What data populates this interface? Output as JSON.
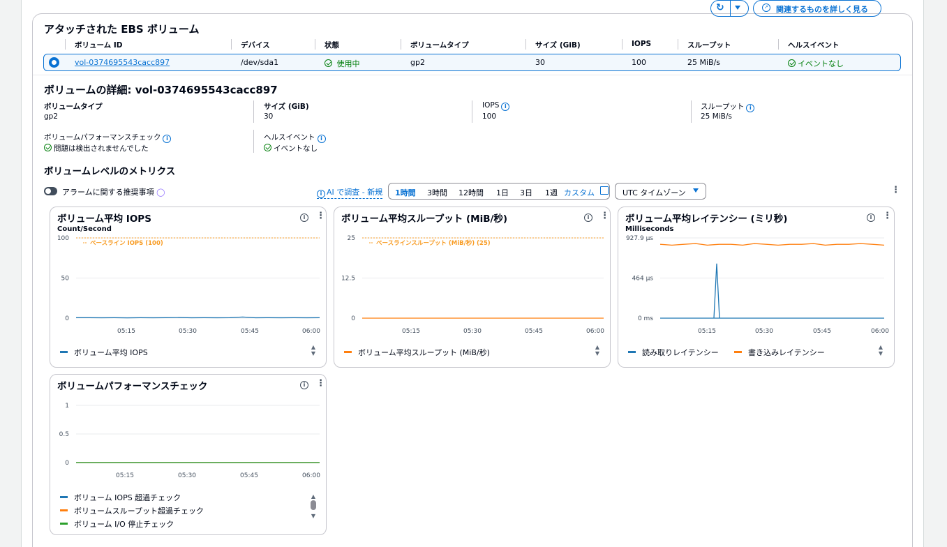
{
  "attached": {
    "title": "アタッチされた EBS ボリューム",
    "columns": [
      "ボリューム ID",
      "デバイス",
      "状態",
      "ボリュームタイプ",
      "サイズ (GiB)",
      "IOPS",
      "スループット",
      "ヘルスイベント"
    ],
    "row": {
      "volume_id": "vol-0374695543cacc897",
      "device": "/dev/sda1",
      "state": "使用中",
      "type": "gp2",
      "size": "30",
      "iops": "100",
      "throughput": "25 MiB/s",
      "health": "イベントなし"
    }
  },
  "details": {
    "title": "ボリュームの詳細: vol-0374695543cacc897",
    "type_label": "ボリュームタイプ",
    "type_value": "gp2",
    "size_label": "サイズ (GiB)",
    "size_value": "30",
    "iops_label": "IOPS",
    "iops_value": "100",
    "throughput_label": "スループット",
    "throughput_value": "25 MiB/s",
    "perf_label": "ボリュームパフォーマンスチェック",
    "perf_value": "問題は検出されませんでした",
    "health_label": "ヘルスイベント",
    "health_value": "イベントなし"
  },
  "metrics": {
    "title": "ボリュームレベルのメトリクス",
    "alarm_toggle": "アラームに関する推奨事項",
    "ai_link": "AI で調査 - 新規",
    "ranges": [
      "1時間",
      "3時間",
      "12時間",
      "1日",
      "3日",
      "1週",
      "カスタム"
    ],
    "selected_range": "1時間",
    "timezone": "UTC タイムゾーン",
    "related_button": "関連するものを詳しく見る"
  },
  "colors": {
    "blue": "#1f77b4",
    "orange": "#ff7f0e",
    "green": "#2ca02c",
    "baseline": "#f89c24",
    "link": "#0972d3",
    "ok": "#037f0c"
  },
  "chart_data": [
    {
      "type": "line",
      "title": "ボリューム平均 IOPS",
      "ylabel": "Count/Second",
      "y_ticks": [
        "100",
        "50",
        "0"
      ],
      "x_ticks": [
        "05:15",
        "05:30",
        "05:45",
        "06:00"
      ],
      "ylim": [
        0,
        100
      ],
      "series": [
        {
          "name": "ボリューム平均 IOPS",
          "values": [
            0.6,
            0.6,
            0.5,
            0.6,
            0.4,
            0.6,
            0.5,
            0.6,
            0.8,
            0.5,
            0.6,
            0.5,
            0.6,
            1.4,
            0.5,
            0.6,
            0.5,
            0.6,
            0.5,
            0.6
          ]
        }
      ],
      "annotations": [
        "ベースライン IOPS (100)"
      ]
    },
    {
      "type": "line",
      "title": "ボリューム平均スループット (MiB/秒)",
      "y_ticks": [
        "25",
        "12.5",
        "0"
      ],
      "x_ticks": [
        "05:15",
        "05:30",
        "05:45",
        "06:00"
      ],
      "ylim": [
        0,
        25
      ],
      "series": [
        {
          "name": "ボリューム平均スループット (MiB/秒)",
          "values": [
            0,
            0,
            0,
            0,
            0,
            0,
            0,
            0,
            0,
            0,
            0,
            0,
            0,
            0,
            0,
            0,
            0,
            0,
            0,
            0
          ]
        }
      ],
      "annotations": [
        "ベースラインスループット (MiB/秒) (25)"
      ]
    },
    {
      "type": "line",
      "title": "ボリューム平均レイテンシー (ミリ秒)",
      "ylabel": "Milliseconds",
      "y_ticks": [
        "927.9 μs",
        "464 μs",
        "0 ms"
      ],
      "x_ticks": [
        "05:15",
        "05:30",
        "05:45",
        "06:00"
      ],
      "series": [
        {
          "name": "読み取りレイテンシー",
          "values": [
            0,
            0,
            0,
            0,
            0,
            0,
            0,
            0,
            0,
            0,
            0,
            0,
            0,
            0,
            0,
            0,
            0,
            0,
            0,
            0
          ]
        },
        {
          "name": "書き込みレイテンシー",
          "values": [
            0.92,
            0.91,
            0.92,
            0.93,
            0.91,
            0.92,
            0.92,
            0.91,
            0.93,
            0.92,
            0.91,
            0.92,
            0.92,
            0.93,
            0.91,
            0.92,
            0.92,
            0.93,
            0.92,
            0.91
          ]
        }
      ]
    },
    {
      "type": "line",
      "title": "ボリュームパフォーマンスチェック",
      "y_ticks": [
        "1",
        "0.5",
        "0"
      ],
      "x_ticks": [
        "05:15",
        "05:30",
        "05:45",
        "06:00"
      ],
      "ylim": [
        0,
        1
      ],
      "series": [
        {
          "name": "ボリューム IOPS 超過チェック",
          "values": [
            0,
            0,
            0,
            0
          ]
        },
        {
          "name": "ボリュームスループット超過チェック",
          "values": [
            0,
            0,
            0,
            0
          ]
        },
        {
          "name": "ボリューム I/O 停止チェック",
          "values": [
            0,
            0,
            0,
            0
          ]
        }
      ]
    }
  ]
}
